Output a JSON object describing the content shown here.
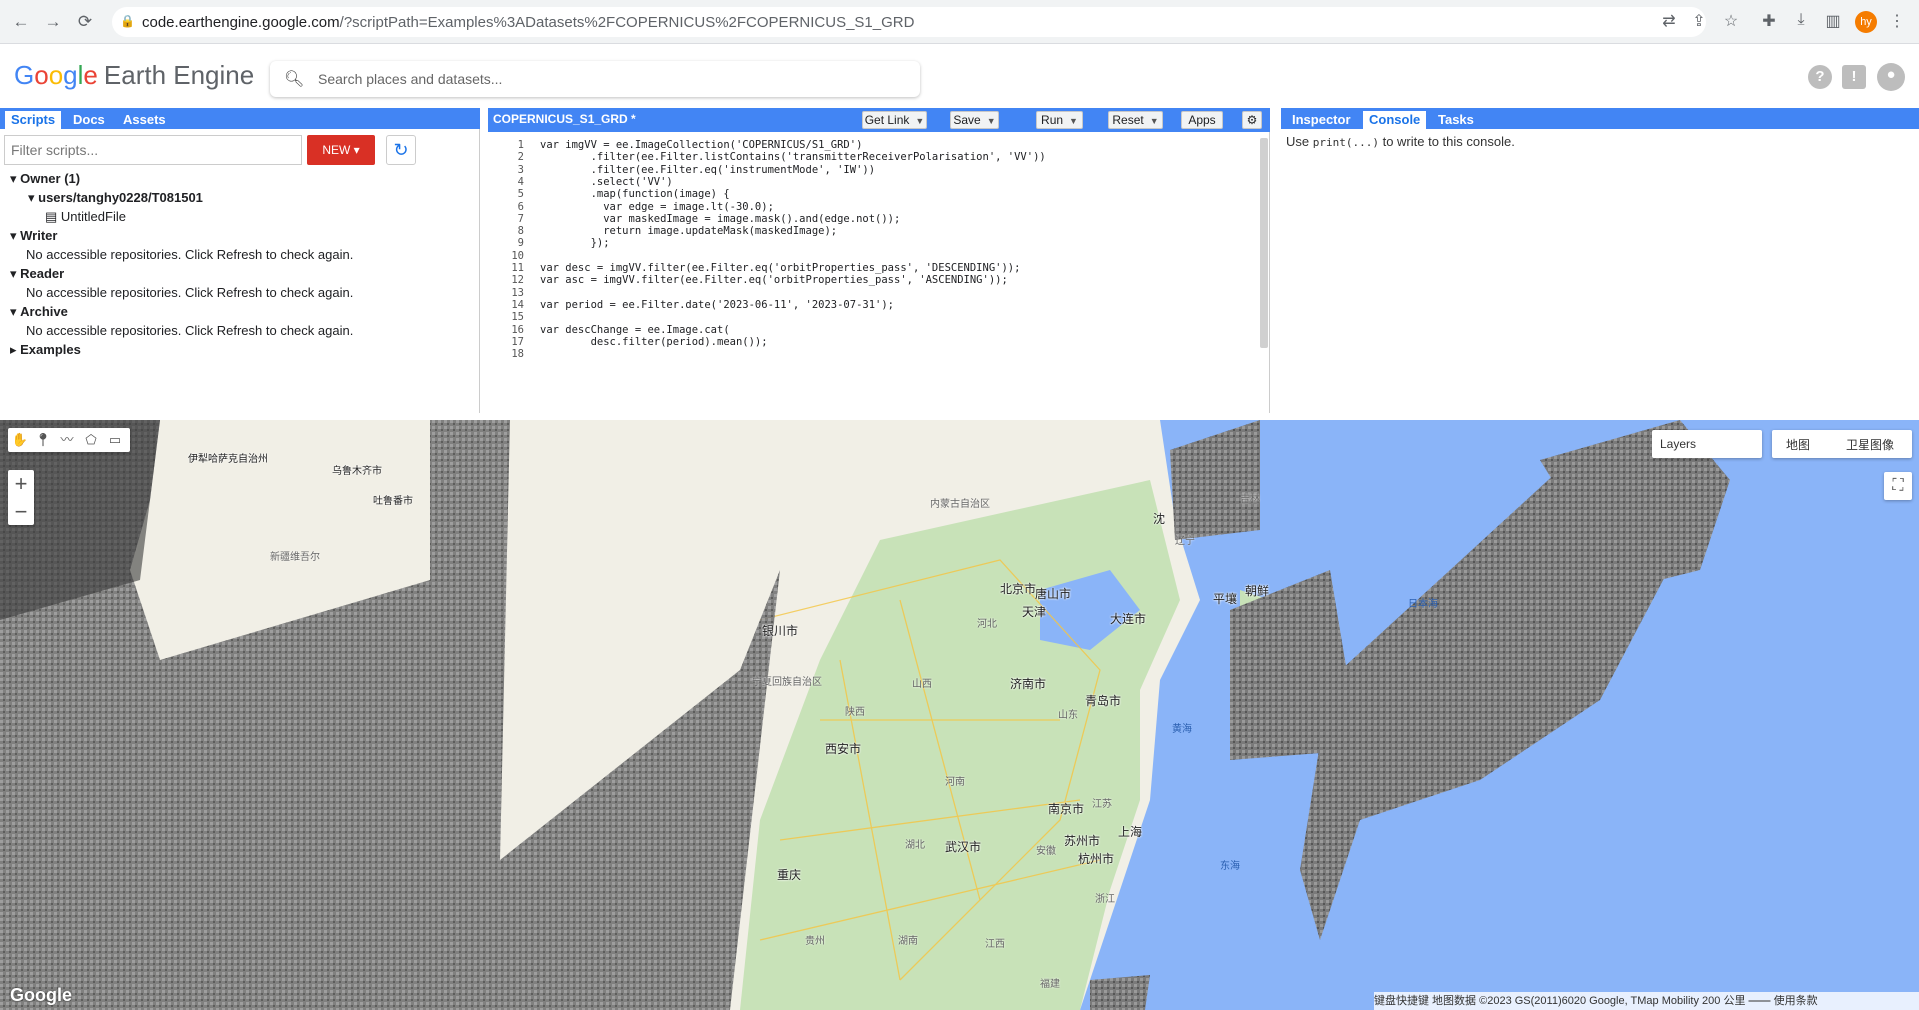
{
  "browser": {
    "url_host": "code.earthengine.google.com",
    "url_path": "/?scriptPath=Examples%3ADatasets%2FCOPERNICUS%2FCOPERNICUS_S1_GRD",
    "profile_initials": "hy"
  },
  "header": {
    "logo_google": [
      "G",
      "o",
      "o",
      "g",
      "l",
      "e"
    ],
    "logo_product": "Earth Engine",
    "search_placeholder": "Search places and datasets..."
  },
  "left_panel": {
    "tabs": [
      "Scripts",
      "Docs",
      "Assets"
    ],
    "filter_placeholder": "Filter scripts...",
    "new_button": "NEW",
    "tree": {
      "owner": "Owner (1)",
      "owner_repo": "users/tanghy0228/T081501",
      "owner_file": "UntitledFile",
      "writer": "Writer",
      "writer_msg": "No accessible repositories. Click Refresh to check again.",
      "reader": "Reader",
      "reader_msg": "No accessible repositories. Click Refresh to check again.",
      "archive": "Archive",
      "archive_msg": "No accessible repositories. Click Refresh to check again.",
      "examples": "Examples"
    }
  },
  "editor": {
    "title": "COPERNICUS_S1_GRD *",
    "buttons": {
      "get_link": "Get Link",
      "save": "Save",
      "run": "Run",
      "reset": "Reset",
      "apps": "Apps"
    },
    "line_numbers": [
      "1",
      "2",
      "3",
      "4",
      "5",
      "6",
      "7",
      "8",
      "9",
      "10",
      "11",
      "12",
      "13",
      "14",
      "15",
      "16",
      "17",
      "18"
    ],
    "lines": [
      "var imgVV = ee.ImageCollection('COPERNICUS/S1_GRD')",
      "        .filter(ee.Filter.listContains('transmitterReceiverPolarisation', 'VV'))",
      "        .filter(ee.Filter.eq('instrumentMode', 'IW'))",
      "        .select('VV')",
      "        .map(function(image) {",
      "          var edge = image.lt(-30.0);",
      "          var maskedImage = image.mask().and(edge.not());",
      "          return image.updateMask(maskedImage);",
      "        });",
      "",
      "var desc = imgVV.filter(ee.Filter.eq('orbitProperties_pass', 'DESCENDING'));",
      "var asc = imgVV.filter(ee.Filter.eq('orbitProperties_pass', 'ASCENDING'));",
      "",
      "var period = ee.Filter.date('2023-06-11', '2023-07-31');",
      "",
      "var descChange = ee.Image.cat(",
      "        desc.filter(period).mean());",
      ""
    ]
  },
  "right_panel": {
    "tabs": [
      "Inspector",
      "Console",
      "Tasks"
    ],
    "console_msg_pre": "Use ",
    "console_msg_code": "print(...)",
    "console_msg_post": " to write to this console."
  },
  "map": {
    "layers_label": "Layers",
    "map_type_map": "地图",
    "map_type_satellite": "卫星图像",
    "google_logo": "Google",
    "attribution": "键盘快捷键   地图数据 ©2023 GS(2011)6020 Google, TMap Mobility   200 公里 ⎯⎯⎯⎯   使用条款",
    "cities": [
      {
        "name": "北京市"
      },
      {
        "name": "天津"
      },
      {
        "name": "唐山市"
      },
      {
        "name": "大连市"
      },
      {
        "name": "青岛市"
      },
      {
        "name": "济南市"
      },
      {
        "name": "西安市"
      },
      {
        "name": "南京市"
      },
      {
        "name": "上海"
      },
      {
        "name": "苏州市"
      },
      {
        "name": "杭州市"
      },
      {
        "name": "武汉市"
      },
      {
        "name": "重庆"
      },
      {
        "name": "银川市"
      },
      {
        "name": "平壤"
      },
      {
        "name": "朝鲜"
      },
      {
        "name": "伊犁哈萨克自治州"
      },
      {
        "name": "乌鲁木齐市"
      },
      {
        "name": "吐鲁番市"
      },
      {
        "name": "沈"
      }
    ],
    "provinces": [
      {
        "name": "内蒙古自治区"
      },
      {
        "name": "宁夏回族自治区"
      },
      {
        "name": "陕西"
      },
      {
        "name": "山西"
      },
      {
        "name": "河北"
      },
      {
        "name": "山东"
      },
      {
        "name": "河南"
      },
      {
        "name": "湖北"
      },
      {
        "name": "安徽"
      },
      {
        "name": "江苏"
      },
      {
        "name": "浙江"
      },
      {
        "name": "湖南"
      },
      {
        "name": "贵州"
      },
      {
        "name": "江西"
      },
      {
        "name": "福建"
      },
      {
        "name": "辽宁"
      },
      {
        "name": "吉林"
      },
      {
        "name": "新疆维吾尔"
      }
    ],
    "seas": [
      {
        "name": "日本海"
      },
      {
        "name": "黄海"
      },
      {
        "name": "东海"
      }
    ]
  }
}
